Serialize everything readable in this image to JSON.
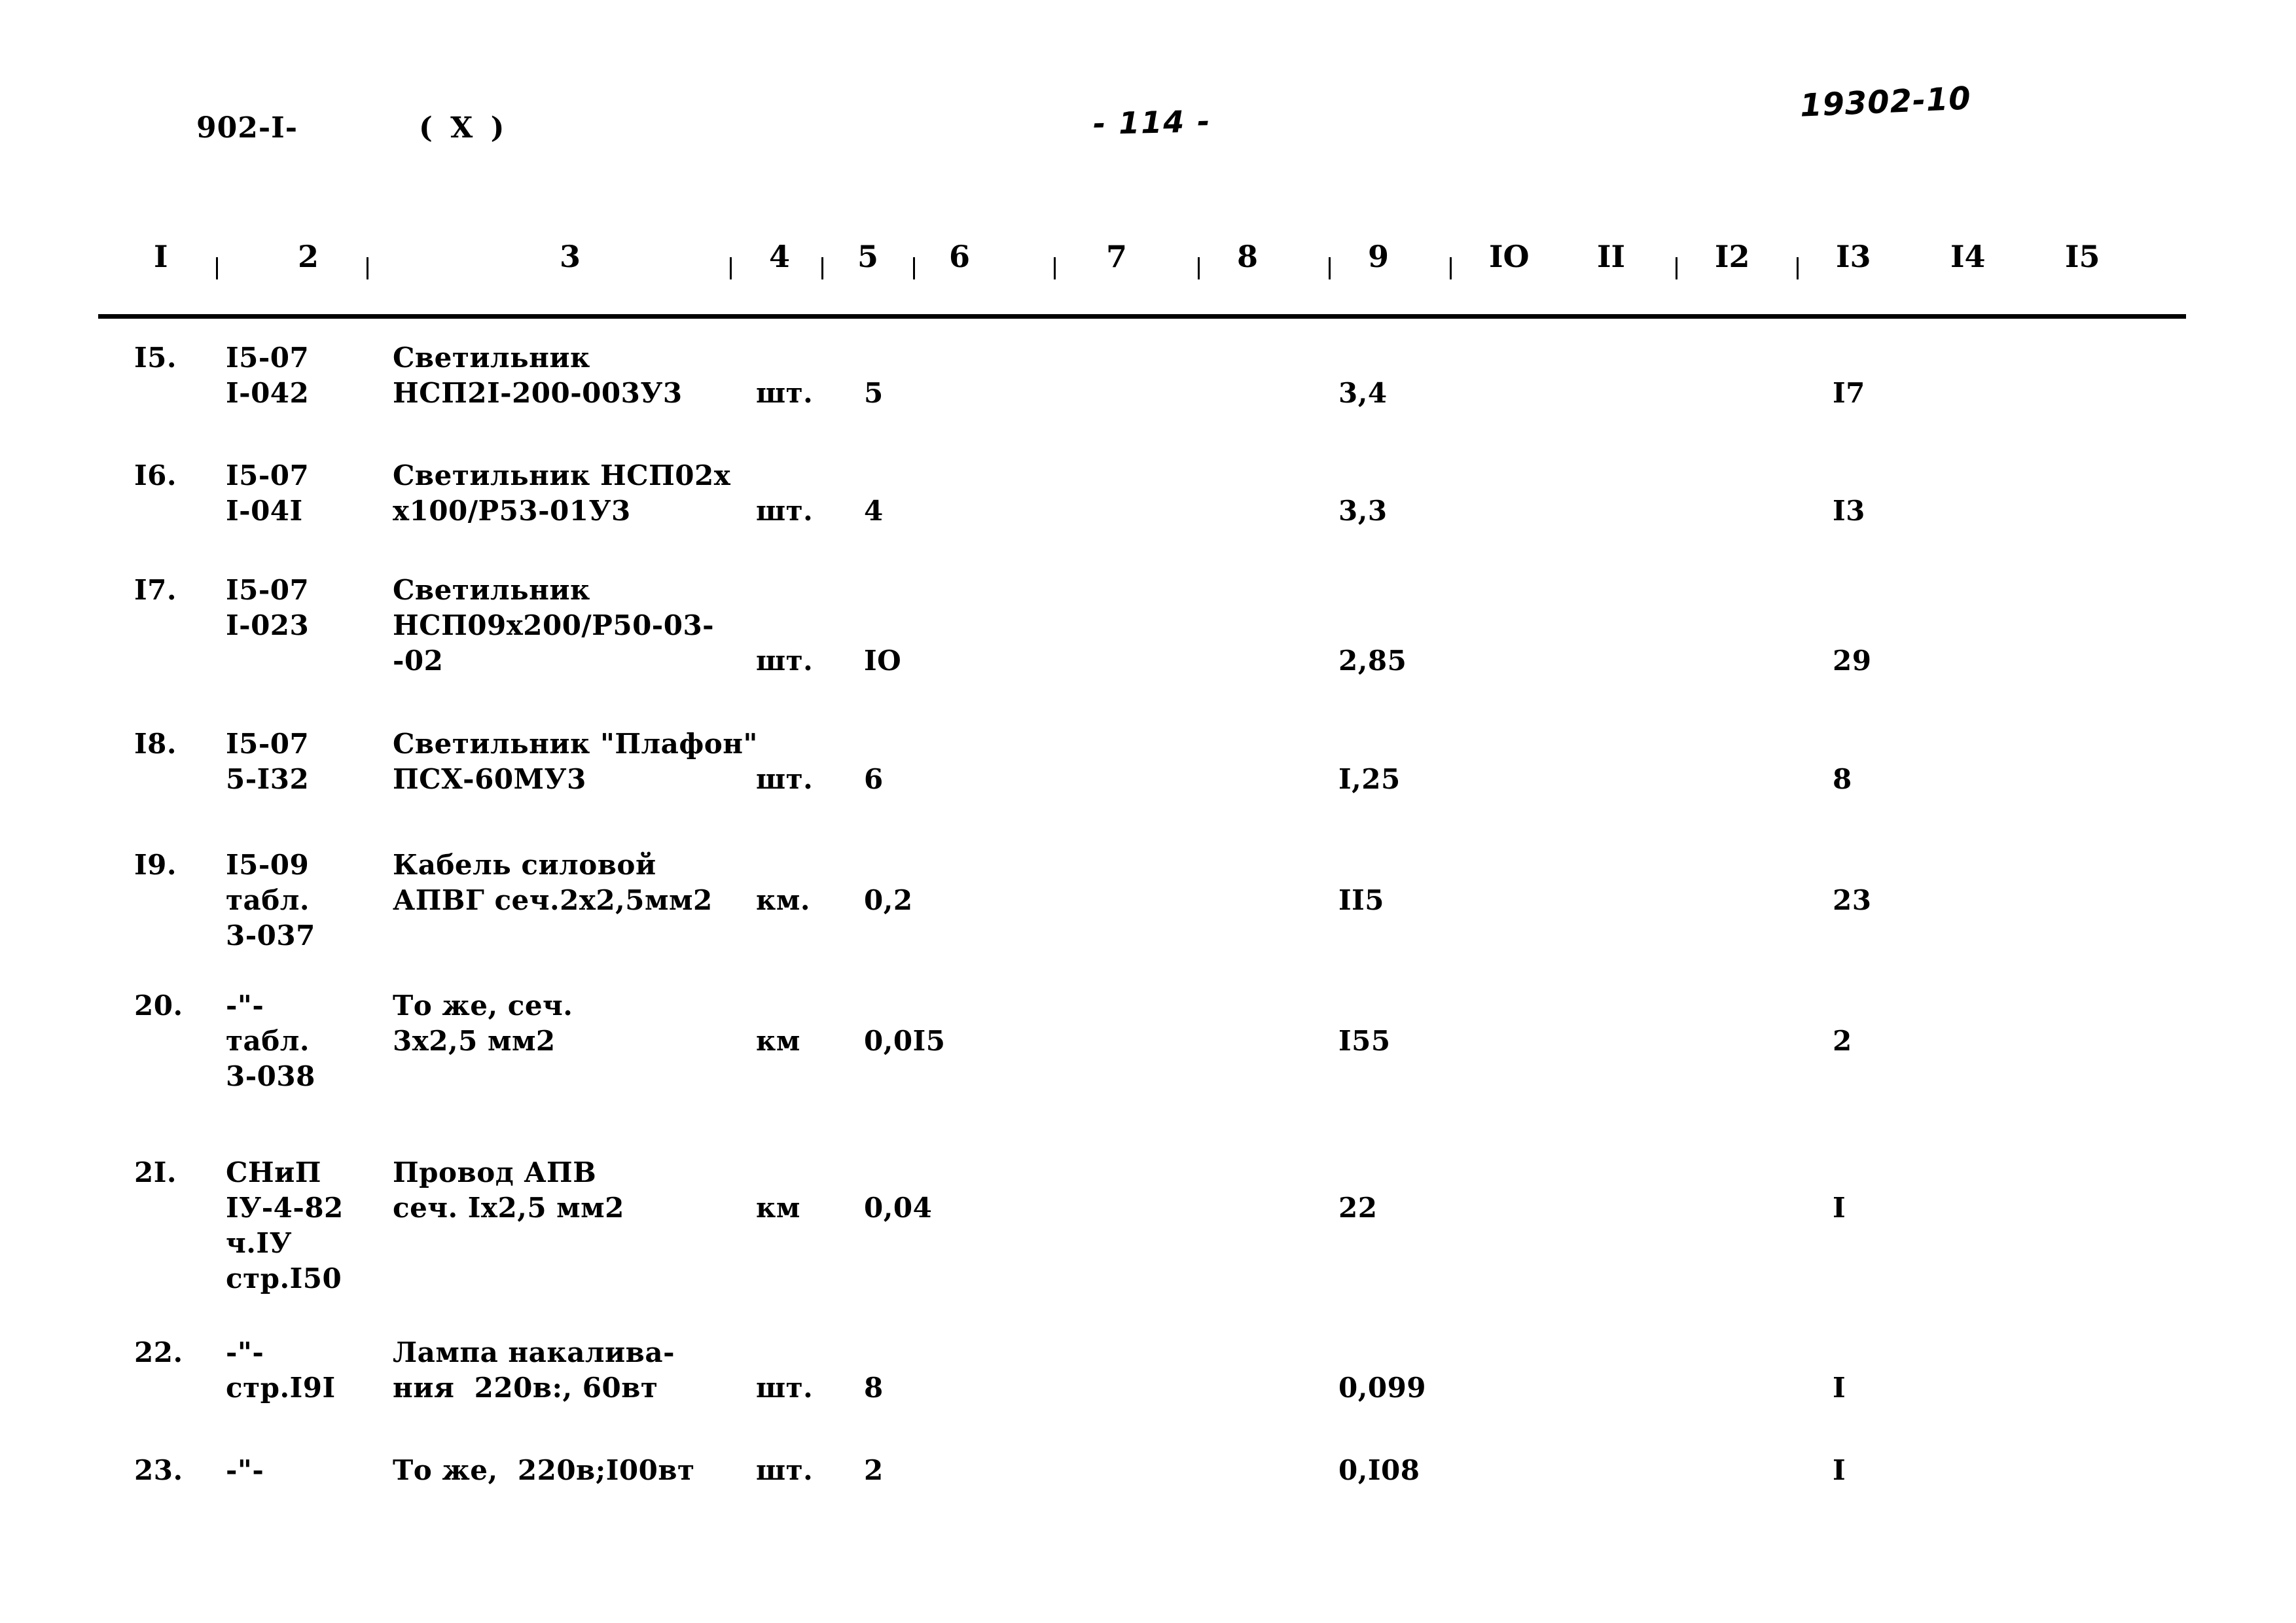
{
  "header": {
    "doc_code": "902-I-",
    "variant_mark": "( X )",
    "page_number": "- 114 -",
    "archive_stamp": "19302-10"
  },
  "table": {
    "column_headers": [
      "I",
      "2",
      "3",
      "4",
      "5",
      "6",
      "7",
      "8",
      "9",
      "IO",
      "II",
      "I2",
      "I3",
      "I4",
      "I5"
    ],
    "rows": [
      {
        "num": "I5.",
        "justification_lines": [
          "I5-07",
          "I-042"
        ],
        "name_lines": [
          "Светильник",
          "НСП2I-200-003У3"
        ],
        "unit": "шт.",
        "qty": "5",
        "col9": "3,4",
        "col13": "I7",
        "unit_line": 1,
        "qty_line": 1
      },
      {
        "num": "I6.",
        "justification_lines": [
          "I5-07",
          "I-04I"
        ],
        "name_lines": [
          "Светильник НСП02х",
          "х100/Р53-01У3"
        ],
        "unit": "шт.",
        "qty": "4",
        "col9": "3,3",
        "col13": "I3",
        "unit_line": 1,
        "qty_line": 1
      },
      {
        "num": "I7.",
        "justification_lines": [
          "I5-07",
          "I-023"
        ],
        "name_lines": [
          "Светильник",
          "НСП09х200/Р50-03-",
          "-02"
        ],
        "unit": "шт.",
        "qty": "IO",
        "col9": "2,85",
        "col13": "29",
        "unit_line": 2,
        "qty_line": 2
      },
      {
        "num": "I8.",
        "justification_lines": [
          "I5-07",
          "5-I32"
        ],
        "name_lines": [
          "Светильник \"Плафон\"",
          "ПСХ-60МУ3"
        ],
        "unit": "шт.",
        "qty": "6",
        "col9": "I,25",
        "col13": "8",
        "unit_line": 1,
        "qty_line": 1
      },
      {
        "num": "I9.",
        "justification_lines": [
          "I5-09",
          "табл.",
          "3-037"
        ],
        "name_lines": [
          "Кабель силовой",
          "АПВГ сеч.2х2,5мм2"
        ],
        "unit": "км.",
        "qty": "0,2",
        "col9": "II5",
        "col13": "23",
        "unit_line": 1,
        "qty_line": 1
      },
      {
        "num": "20.",
        "justification_lines": [
          "-\"-",
          "табл.",
          "3-038"
        ],
        "name_lines": [
          "То же, сеч.",
          "3х2,5 мм2"
        ],
        "unit": "км",
        "qty": "0,0I5",
        "col9": "I55",
        "col13": "2",
        "unit_line": 1,
        "qty_line": 1
      },
      {
        "num": "2I.",
        "justification_lines": [
          "СНиП",
          "IУ-4-82",
          "ч.IУ",
          "стр.I50"
        ],
        "name_lines": [
          "Провод АПВ",
          "сеч. Iх2,5 мм2"
        ],
        "unit": "км",
        "qty": "0,04",
        "col9": "22",
        "col13": "I",
        "unit_line": 1,
        "qty_line": 1
      },
      {
        "num": "22.",
        "justification_lines": [
          "-\"-",
          "стр.I9I"
        ],
        "name_lines": [
          "Лампа накалива-",
          "ния  220в:, 60вт"
        ],
        "unit": "шт.",
        "qty": "8",
        "col9": "0,099",
        "col13": "I",
        "unit_line": 1,
        "qty_line": 1
      },
      {
        "num": "23.",
        "justification_lines": [
          "-\"-"
        ],
        "name_lines": [
          "То же,  220в;I00вт"
        ],
        "unit": "шт.",
        "qty": "2",
        "col9": "0,I08",
        "col13": "I",
        "unit_line": 0,
        "qty_line": 0
      }
    ]
  }
}
